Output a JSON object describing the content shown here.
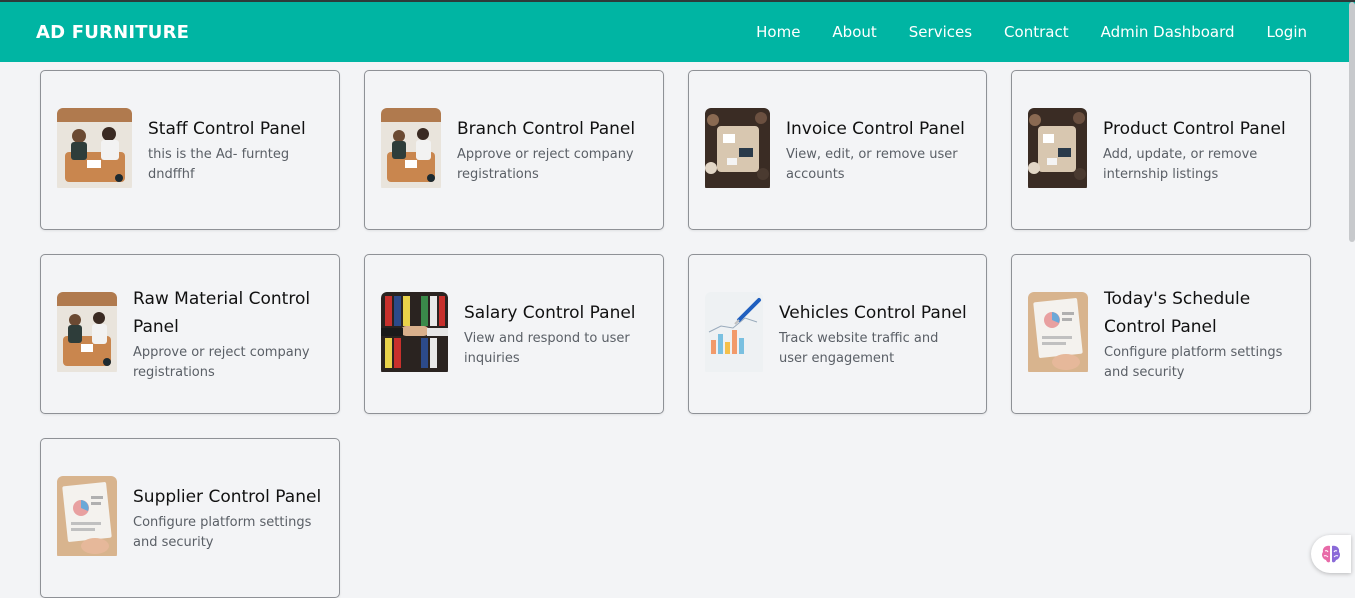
{
  "navbar": {
    "brand": "AD FURNITURE",
    "links": [
      "Home",
      "About",
      "Services",
      "Contract",
      "Admin Dashboard",
      "Login"
    ],
    "background": "#00b5a3"
  },
  "cards": [
    {
      "title": "Staff Control Panel",
      "desc": "this is the Ad- furnteg dndffhf",
      "image": "meeting-photo"
    },
    {
      "title": "Branch Control Panel",
      "desc": "Approve or reject company registrations",
      "image": "meeting-photo"
    },
    {
      "title": "Invoice Control Panel",
      "desc": "View, edit, or remove user accounts",
      "image": "team-table-photo"
    },
    {
      "title": "Product Control Panel",
      "desc": "Add, update, or remove internship listings",
      "image": "team-table-photo"
    },
    {
      "title": "Raw Material Control Panel",
      "desc": "Approve or reject company registrations",
      "image": "meeting-photo"
    },
    {
      "title": "Salary Control Panel",
      "desc": "View and respond to user inquiries",
      "image": "handshake-photo"
    },
    {
      "title": "Vehicles Control Panel",
      "desc": "Track website traffic and user engagement",
      "image": "chart-photo"
    },
    {
      "title": "Today's Schedule Control Panel",
      "desc": "Configure platform settings and security",
      "image": "report-photo"
    },
    {
      "title": "Supplier Control Panel",
      "desc": "Configure platform settings and security",
      "image": "report-photo"
    }
  ],
  "fab": {
    "icon": "brain-icon"
  }
}
